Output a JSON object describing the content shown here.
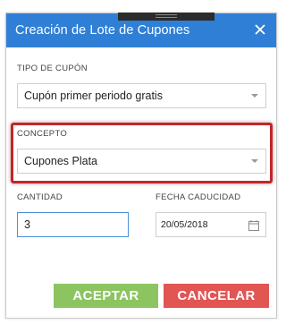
{
  "dialog": {
    "title": "Creación de Lote de Cupones",
    "close_icon": "close-icon",
    "grip_icon": "drag-handle-icon"
  },
  "tipo_cupon": {
    "label": "TIPO DE CUPÓN",
    "value": "Cupón primer periodo gratis"
  },
  "concepto": {
    "label": "CONCEPTO",
    "value": "Cupones Plata"
  },
  "cantidad": {
    "label": "CANTIDAD",
    "value": "3"
  },
  "fecha_caducidad": {
    "label": "FECHA CADUCIDAD",
    "value": "20/05/2018",
    "icon": "calendar-icon"
  },
  "buttons": {
    "accept_label": "ACEPTAR",
    "cancel_label": "CANCELAR"
  },
  "colors": {
    "titlebar": "#2f7fd6",
    "accept": "#8cc460",
    "cancel": "#e15552",
    "highlight": "#c1262c"
  }
}
